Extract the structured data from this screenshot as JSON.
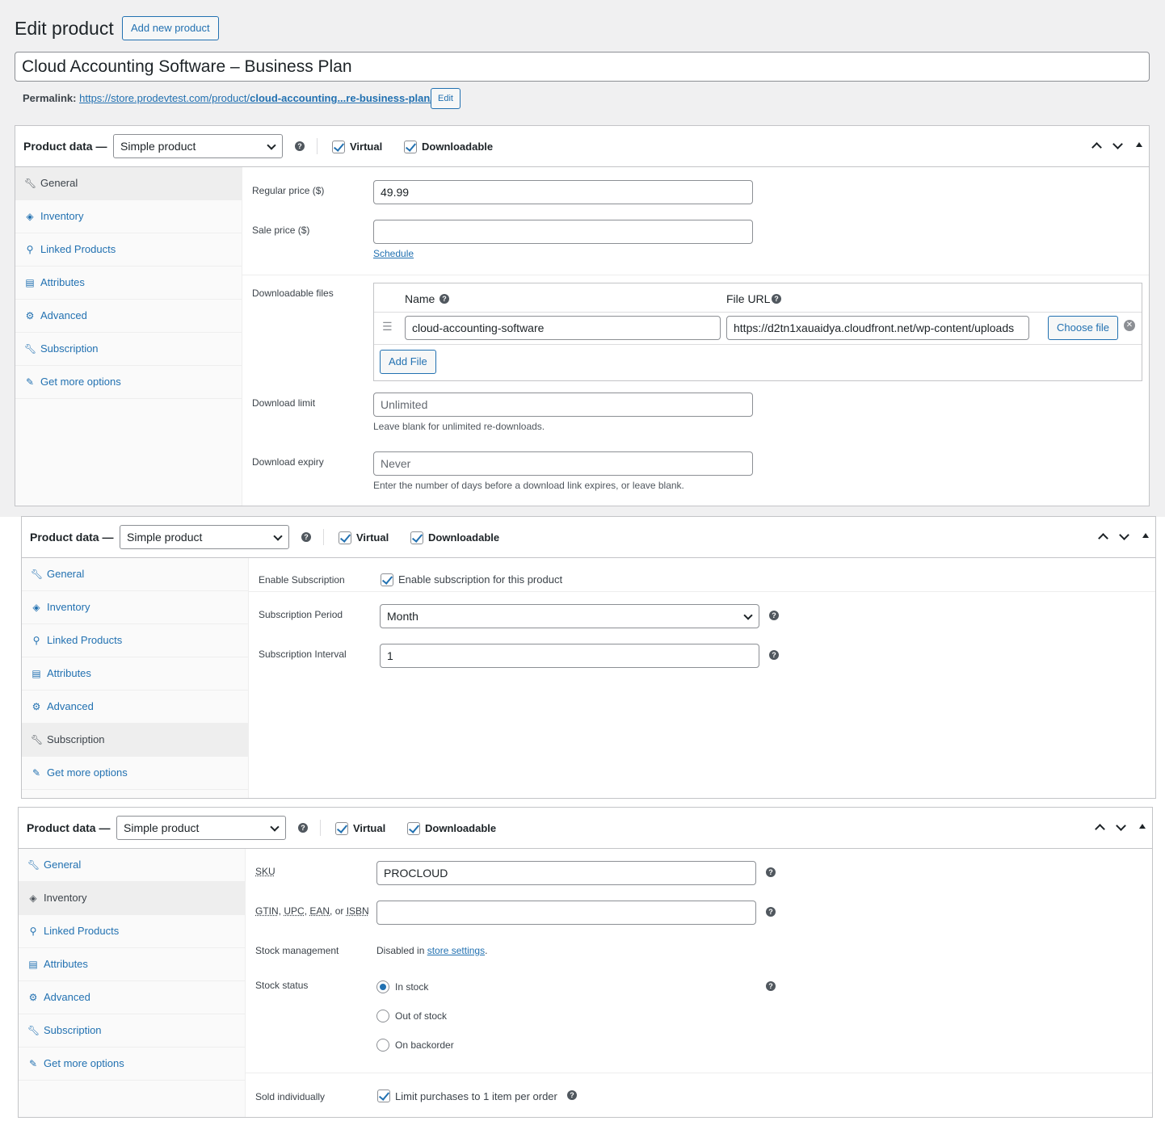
{
  "page": {
    "title": "Edit product",
    "add_new_label": "Add new product",
    "product_title": "Cloud Accounting Software – Business Plan",
    "permalink_label": "Permalink:",
    "permalink_base": "https://store.prodevtest.com/product/",
    "permalink_slug": "cloud-accounting...re-business-plan/",
    "permalink_edit": "Edit"
  },
  "product_data": {
    "label": "Product data —",
    "type_selected": "Simple product",
    "help": "?",
    "virtual_label": "Virtual",
    "downloadable_label": "Downloadable",
    "virtual_checked": true,
    "downloadable_checked": true
  },
  "tabs": [
    {
      "label": "General",
      "icon": "wrench-icon"
    },
    {
      "label": "Inventory",
      "icon": "tag-icon"
    },
    {
      "label": "Linked Products",
      "icon": "link-icon"
    },
    {
      "label": "Attributes",
      "icon": "table-icon"
    },
    {
      "label": "Advanced",
      "icon": "gear-icon"
    },
    {
      "label": "Subscription",
      "icon": "wrench-icon"
    },
    {
      "label": "Get more options",
      "icon": "plugin-icon"
    }
  ],
  "general": {
    "regular_price_label": "Regular price ($)",
    "regular_price": "49.99",
    "sale_price_label": "Sale price ($)",
    "sale_price": "",
    "schedule_link": "Schedule",
    "downloadable_files_label": "Downloadable files",
    "col_name": "Name",
    "col_file_url": "File URL",
    "file_name": "cloud-accounting-software",
    "file_url": "https://d2tn1xauaidya.cloudfront.net/wp-content/uploads",
    "choose_file": "Choose file",
    "add_file": "Add File",
    "download_limit_label": "Download limit",
    "download_limit_placeholder": "Unlimited",
    "download_limit_desc": "Leave blank for unlimited re-downloads.",
    "download_expiry_label": "Download expiry",
    "download_expiry_placeholder": "Never",
    "download_expiry_desc": "Enter the number of days before a download link expires, or leave blank."
  },
  "subscription": {
    "enable_label": "Enable Subscription",
    "enable_text": "Enable subscription for this product",
    "enable_checked": true,
    "period_label": "Subscription Period",
    "period_value": "Month",
    "interval_label": "Subscription Interval",
    "interval_value": "1"
  },
  "inventory": {
    "sku_label": "SKU",
    "sku_value": "PROCLOUD",
    "gtin_label_parts": [
      "GTIN",
      ", ",
      "UPC",
      ", ",
      "EAN",
      ", or ",
      "ISBN"
    ],
    "gtin_value": "",
    "stock_mgmt_label": "Stock management",
    "stock_mgmt_text": "Disabled in",
    "stock_mgmt_link": "store settings",
    "stock_mgmt_end": ".",
    "stock_status_label": "Stock status",
    "stock_options": [
      "In stock",
      "Out of stock",
      "On backorder"
    ],
    "stock_selected": "In stock",
    "sold_individually_label": "Sold individually",
    "sold_individually_text": "Limit purchases to 1 item per order",
    "sold_individually_checked": true
  }
}
